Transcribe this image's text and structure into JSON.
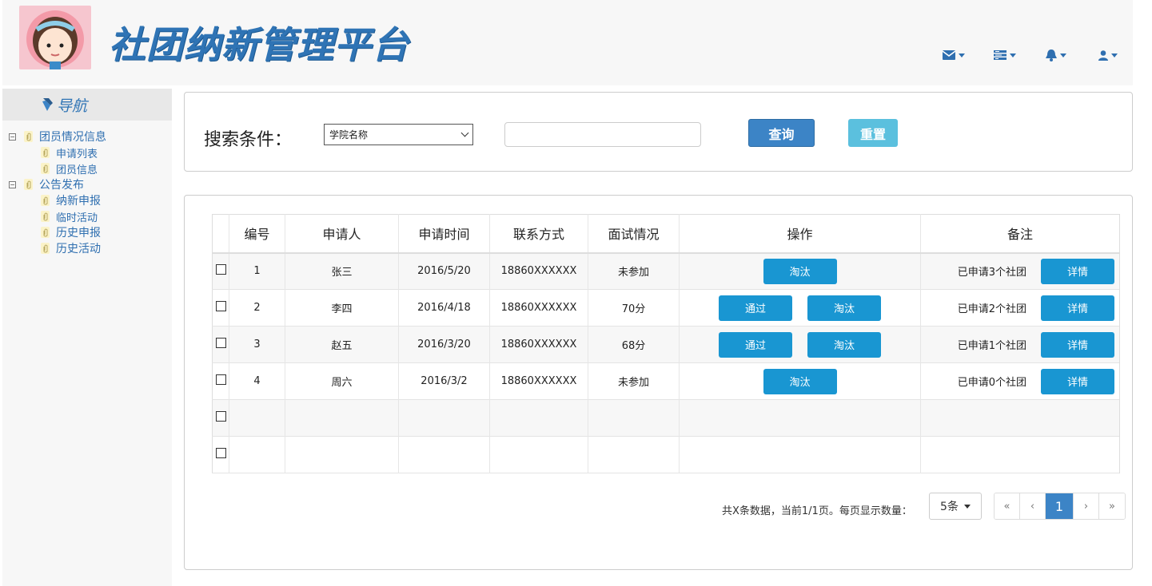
{
  "header": {
    "title": "社团纳新管理平台",
    "icons": [
      "envelope-icon",
      "tasks-icon",
      "bell-icon",
      "user-icon"
    ]
  },
  "sidebar": {
    "title": "导航",
    "groups": [
      {
        "label": "团员情况信息",
        "items": [
          "申请列表",
          "团员信息"
        ]
      },
      {
        "label": "公告发布",
        "items": [
          "纳新申报",
          "临时活动",
          "历史申报",
          "历史活动"
        ]
      }
    ]
  },
  "search": {
    "label": "搜索条件：",
    "select_value": "学院名称",
    "input_value": "",
    "query_label": "查询",
    "reset_label": "重置"
  },
  "table": {
    "headers": [
      "编号",
      "申请人",
      "申请时间",
      "联系方式",
      "面试情况",
      "操作",
      "备注"
    ],
    "rows": [
      {
        "id": "1",
        "name": "张三",
        "date": "2016/5/20",
        "phone": "18860XXXXXX",
        "interview": "未参加",
        "note": "已申请3个社团"
      },
      {
        "id": "2",
        "name": "李四",
        "date": "2016/4/18",
        "phone": "18860XXXXXX",
        "interview": "70分",
        "note": "已申请2个社团"
      },
      {
        "id": "3",
        "name": "赵五",
        "date": "2016/3/20",
        "phone": "18860XXXXXX",
        "interview": "68分",
        "note": "已申请1个社团"
      },
      {
        "id": "4",
        "name": "周六",
        "date": "2016/3/2",
        "phone": "18860XXXXXX",
        "interview": "未参加",
        "note": "已申请0个社团"
      }
    ],
    "pass_label": "通过",
    "eliminate_label": "淘汰",
    "detail_label": "详情"
  },
  "pagination": {
    "info": "共X条数据，当前1/1页。每页显示数量：",
    "page_size": "5条",
    "first": "«",
    "prev": "‹",
    "current": "1",
    "next": "›",
    "last": "»"
  },
  "colors": {
    "brand": "#2f74b5",
    "primary_button": "#3c84c6",
    "info_button": "#5bc0de",
    "action_button": "#1996d2"
  }
}
